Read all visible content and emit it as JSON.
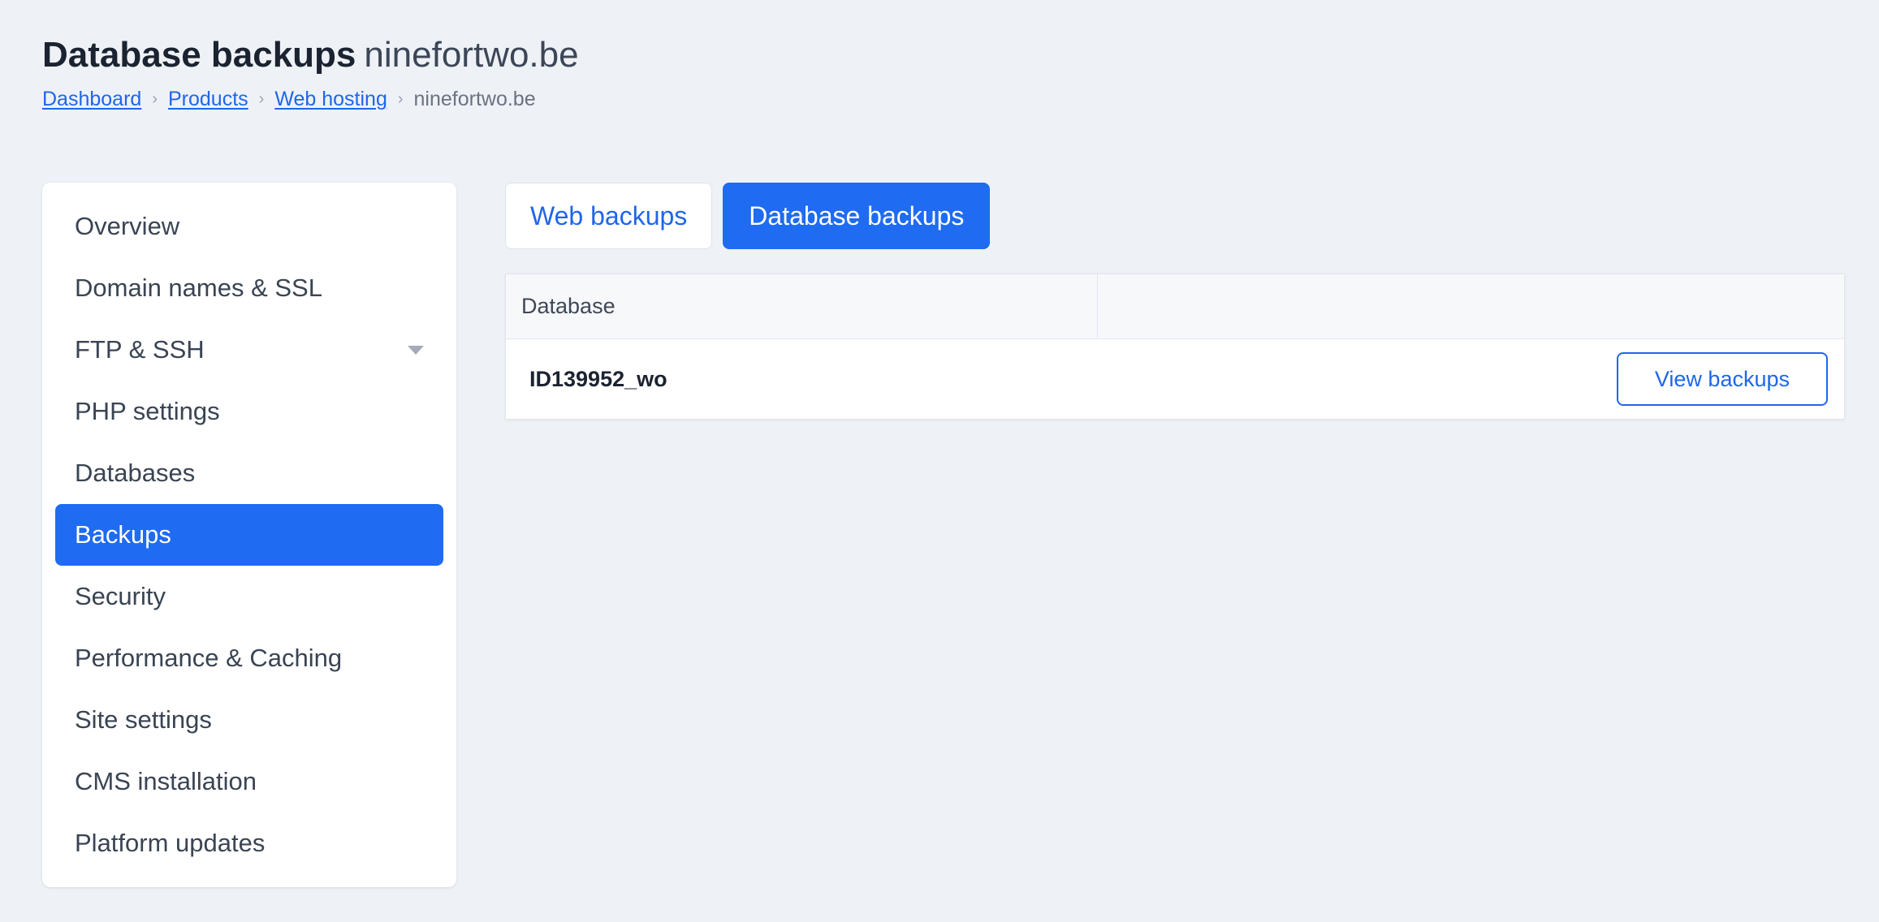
{
  "header": {
    "title_strong": "Database backups",
    "title_domain": "ninefortwo.be"
  },
  "breadcrumb": {
    "items": [
      "Dashboard",
      "Products",
      "Web hosting"
    ],
    "separator": "›",
    "current": "ninefortwo.be"
  },
  "sidebar": {
    "items": [
      {
        "label": "Overview"
      },
      {
        "label": "Domain names & SSL"
      },
      {
        "label": "FTP & SSH",
        "has_dropdown": true
      },
      {
        "label": "PHP settings"
      },
      {
        "label": "Databases"
      },
      {
        "label": "Backups",
        "active": true
      },
      {
        "label": "Security"
      },
      {
        "label": "Performance & Caching"
      },
      {
        "label": "Site settings"
      },
      {
        "label": "CMS installation"
      },
      {
        "label": "Platform updates"
      }
    ],
    "dropdown_icon": "chevron-down-icon"
  },
  "tabs": [
    {
      "label": "Web backups",
      "active": false
    },
    {
      "label": "Database backups",
      "active": true
    }
  ],
  "table": {
    "columns": [
      "Database",
      ""
    ],
    "rows": [
      {
        "database": "ID139952_wo",
        "action_label": "View backups"
      }
    ]
  },
  "colors": {
    "accent": "#1f6bf2",
    "link": "#1f66ea",
    "background": "#eef1f6"
  }
}
